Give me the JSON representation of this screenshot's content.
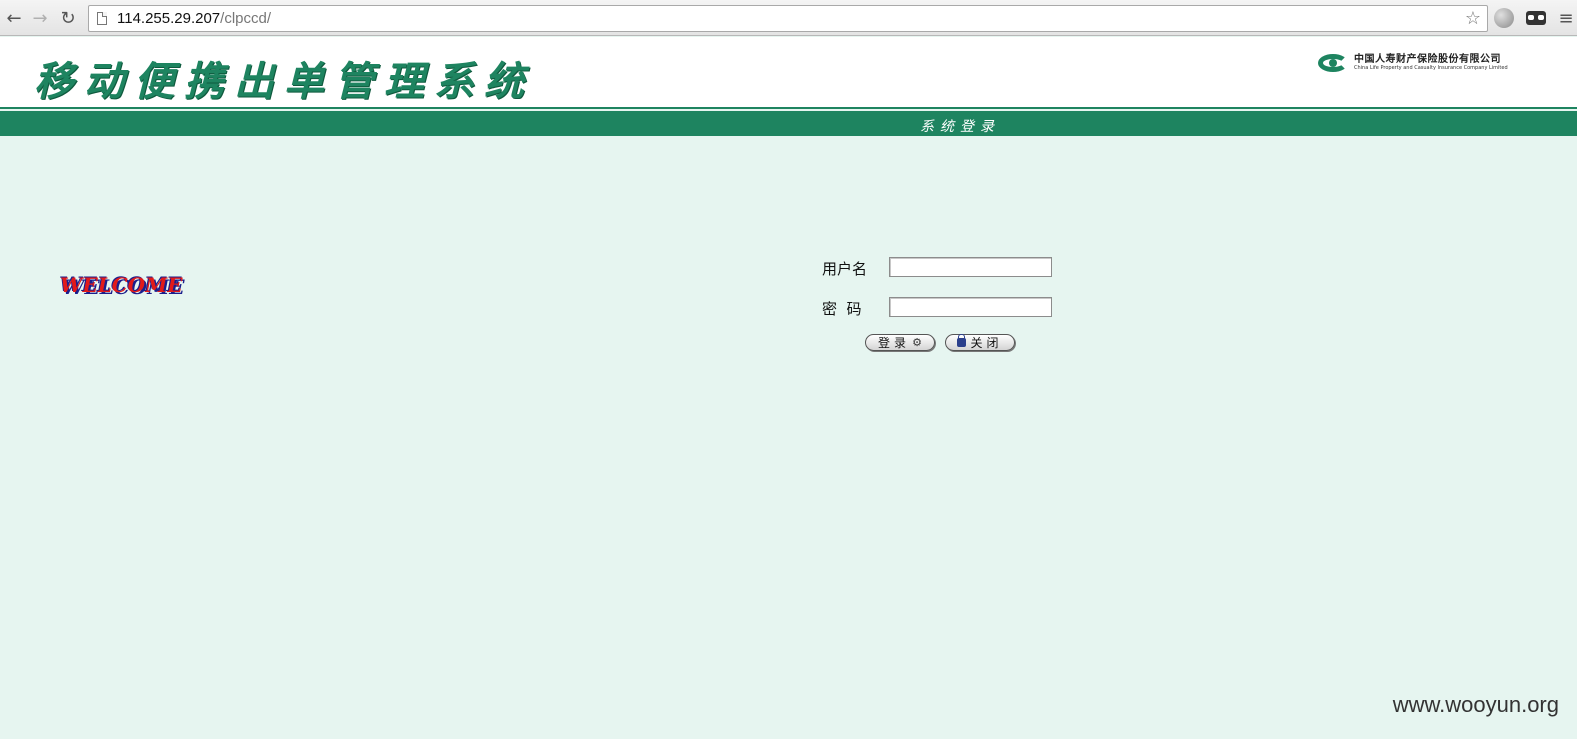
{
  "browser": {
    "url_host": "114.255.29.207",
    "url_path": "/clpccd/",
    "back_icon": "arrow-left",
    "forward_icon": "arrow-right",
    "reload_icon": "reload",
    "star_icon": "star-outline",
    "menu_icon": "hamburger"
  },
  "header": {
    "system_title": "移动便携出单管理系统",
    "logo_cn": "中国人寿财产保险股份有限公司",
    "logo_en": "China Life Property and Casualty Insurance Company Limited"
  },
  "band": {
    "title": "系统登录"
  },
  "welcome": {
    "text": "WELCOME"
  },
  "login": {
    "username_label": "用户名",
    "password_label": "密  码",
    "username_value": "",
    "password_value": "",
    "login_button": "登录",
    "close_button": "关闭"
  },
  "colors": {
    "brand_green": "#1e8460",
    "page_bg": "#e6f5f0",
    "welcome_red": "#e21a1a"
  },
  "watermark": "www.wooyun.org"
}
